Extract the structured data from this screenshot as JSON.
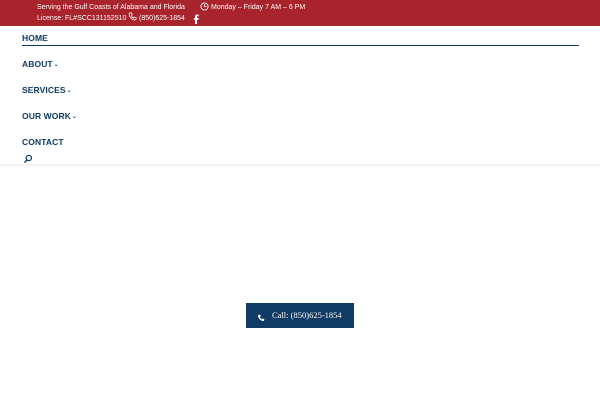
{
  "topbar": {
    "tagline": "Serving the Gulf Coasts of Alabama and Florida",
    "license": "License: FL#SCC131152510",
    "hours": "Monday – Friday 7 AM – 6 PM",
    "phone": "(850)625-1854",
    "icons": [
      "clock-icon",
      "phone-icon",
      "facebook-icon"
    ],
    "bg_color": "#a8232c"
  },
  "nav": {
    "items": [
      {
        "label": "HOME",
        "active": true
      },
      {
        "label": "ABOUT",
        "dropdown": true
      },
      {
        "label": "SERVICES",
        "dropdown": true
      },
      {
        "label": "OUR WORK",
        "dropdown": true
      },
      {
        "label": "CONTACT"
      }
    ],
    "chevron": "⌄",
    "search_icon": "search-icon",
    "color": "#0f3b64"
  },
  "cta": {
    "label": "Call: (850)625-1854",
    "icon": "phone-icon",
    "color": "#0f3b64"
  }
}
